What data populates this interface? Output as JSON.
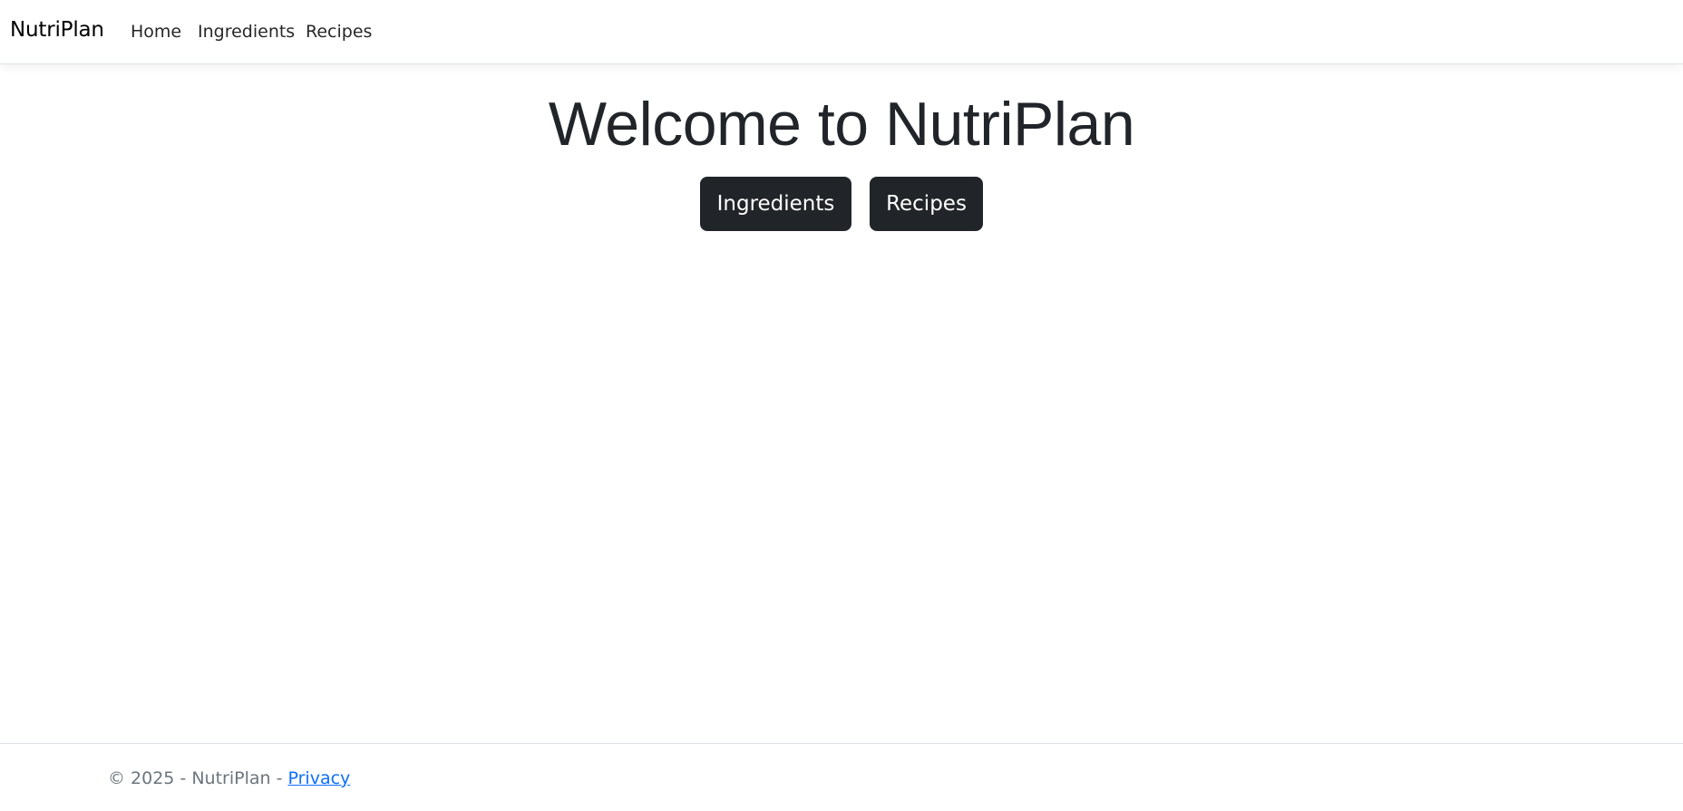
{
  "navbar": {
    "brand": "NutriPlan",
    "links": [
      {
        "label": "Home"
      },
      {
        "label": "Ingredients"
      },
      {
        "label": "Recipes"
      }
    ]
  },
  "main": {
    "title": "Welcome to NutriPlan",
    "buttons": [
      {
        "label": "Ingredients"
      },
      {
        "label": "Recipes"
      }
    ]
  },
  "footer": {
    "copyright": "© 2025 - NutriPlan - ",
    "privacy_label": "Privacy"
  },
  "colors": {
    "button_bg": "#212529",
    "link": "#0d6efd",
    "muted_text": "#6c757d"
  }
}
